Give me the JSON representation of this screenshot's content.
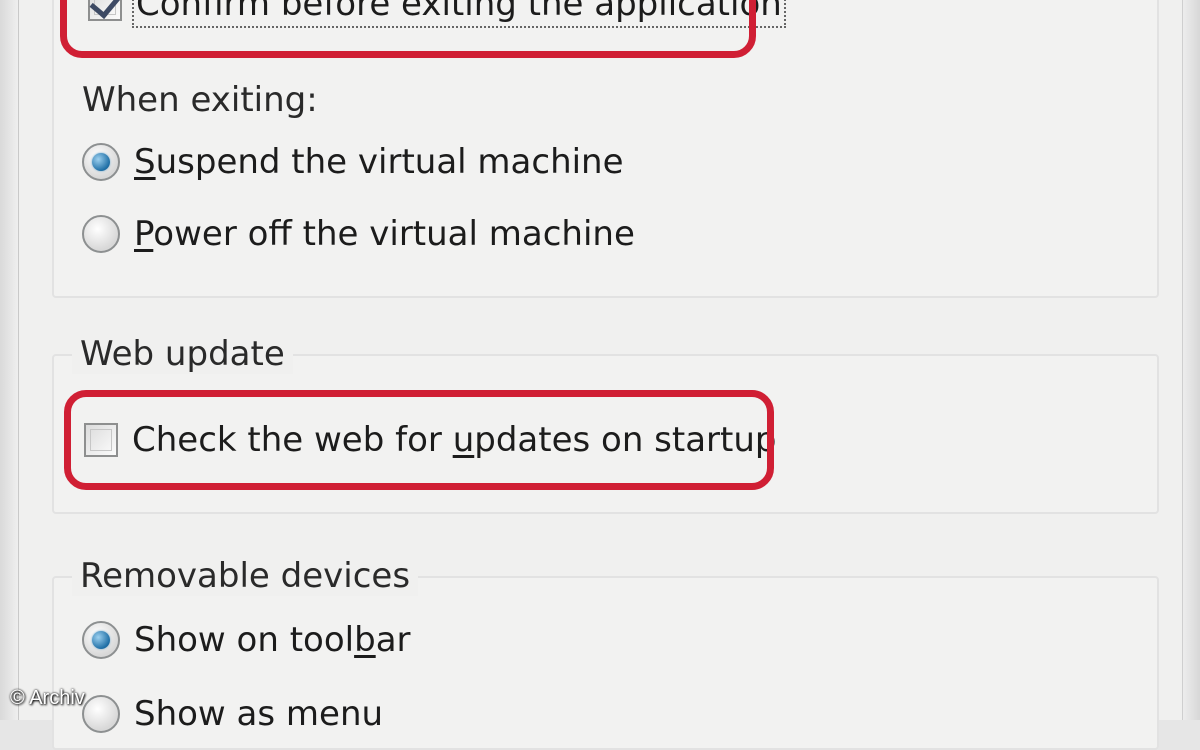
{
  "exit_section": {
    "confirm_checkbox": {
      "label": "Confirm before exiting the application",
      "checked": true
    },
    "when_exiting_label": "When exiting:",
    "options": [
      {
        "label_prefix": "",
        "label_underline": "S",
        "label_rest": "uspend the virtual machine",
        "checked": true
      },
      {
        "label_prefix": "",
        "label_underline": "P",
        "label_rest": "ower off the virtual machine",
        "checked": false
      }
    ]
  },
  "web_update": {
    "legend": "Web update",
    "check_updates": {
      "label_prefix": "Check the web for ",
      "label_underline": "u",
      "label_rest": "pdates on startup",
      "checked": false
    }
  },
  "removable_devices": {
    "legend": "Removable devices",
    "options": [
      {
        "label_prefix": "Show on tool",
        "label_underline": "b",
        "label_rest": "ar",
        "checked": true
      },
      {
        "label_prefix": "Show as menu",
        "label_underline": "",
        "label_rest": "",
        "checked": false
      }
    ]
  },
  "watermark": "© Archiv",
  "colors": {
    "highlight": "#d01f34",
    "radio_selected": "#1f6fa6",
    "background": "#f0f0ef"
  }
}
